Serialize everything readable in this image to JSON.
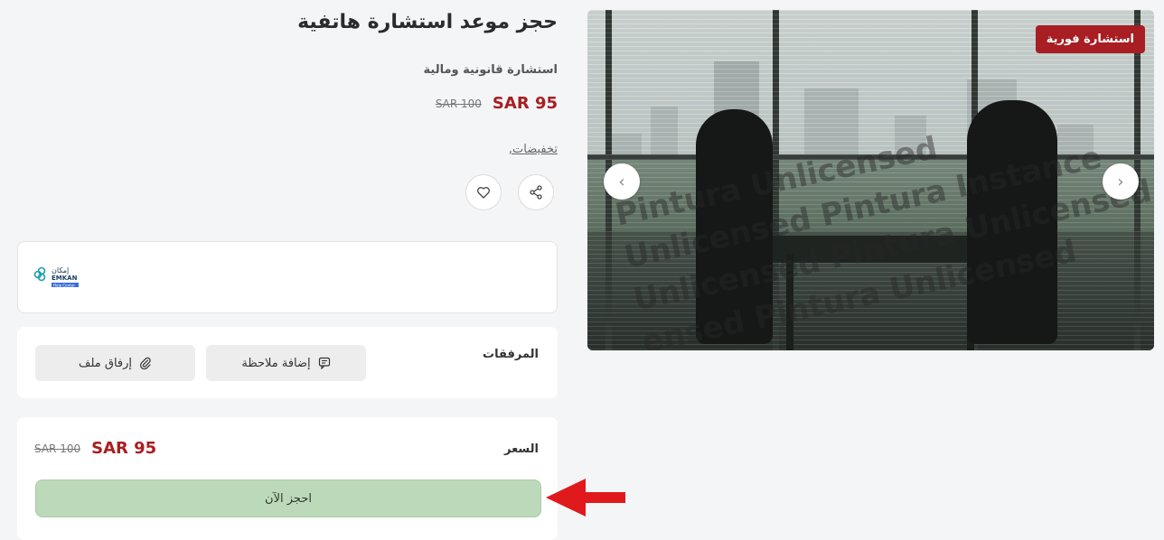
{
  "product": {
    "title": "حجز موعد استشارة هاتفية",
    "category": "استشارة قانونية ومالية",
    "price_new": "SAR 95",
    "price_old": "SAR 100",
    "discounts_link": "تخفيضات,"
  },
  "gallery": {
    "badge": "استشارة فورية",
    "watermark_lines": [
      "Pintura Unlicensed",
      "Unlicensed Pintura Instance",
      "Unlicensed Pintura Unlicensed",
      "ensed Pintura Unlicensed"
    ],
    "prev_icon": "chevron-left-icon",
    "next_icon": "chevron-right-icon"
  },
  "actions": {
    "share_icon": "share-icon",
    "favorite_icon": "heart-icon"
  },
  "provider": {
    "logo_text_ar": "إمكان",
    "logo_text_en": "EMKAN",
    "logo_tag": "Help Center"
  },
  "attachments": {
    "label": "المرفقات",
    "add_note": "إضافة ملاحظة",
    "attach_file": "إرفاق ملف"
  },
  "pricing": {
    "label": "السعر",
    "price_new": "SAR 95",
    "price_old": "SAR 100",
    "book_now": "احجز الآن"
  },
  "colors": {
    "accent": "#a81e22",
    "book_button": "#bcdab9",
    "background": "#f4f5f6"
  }
}
